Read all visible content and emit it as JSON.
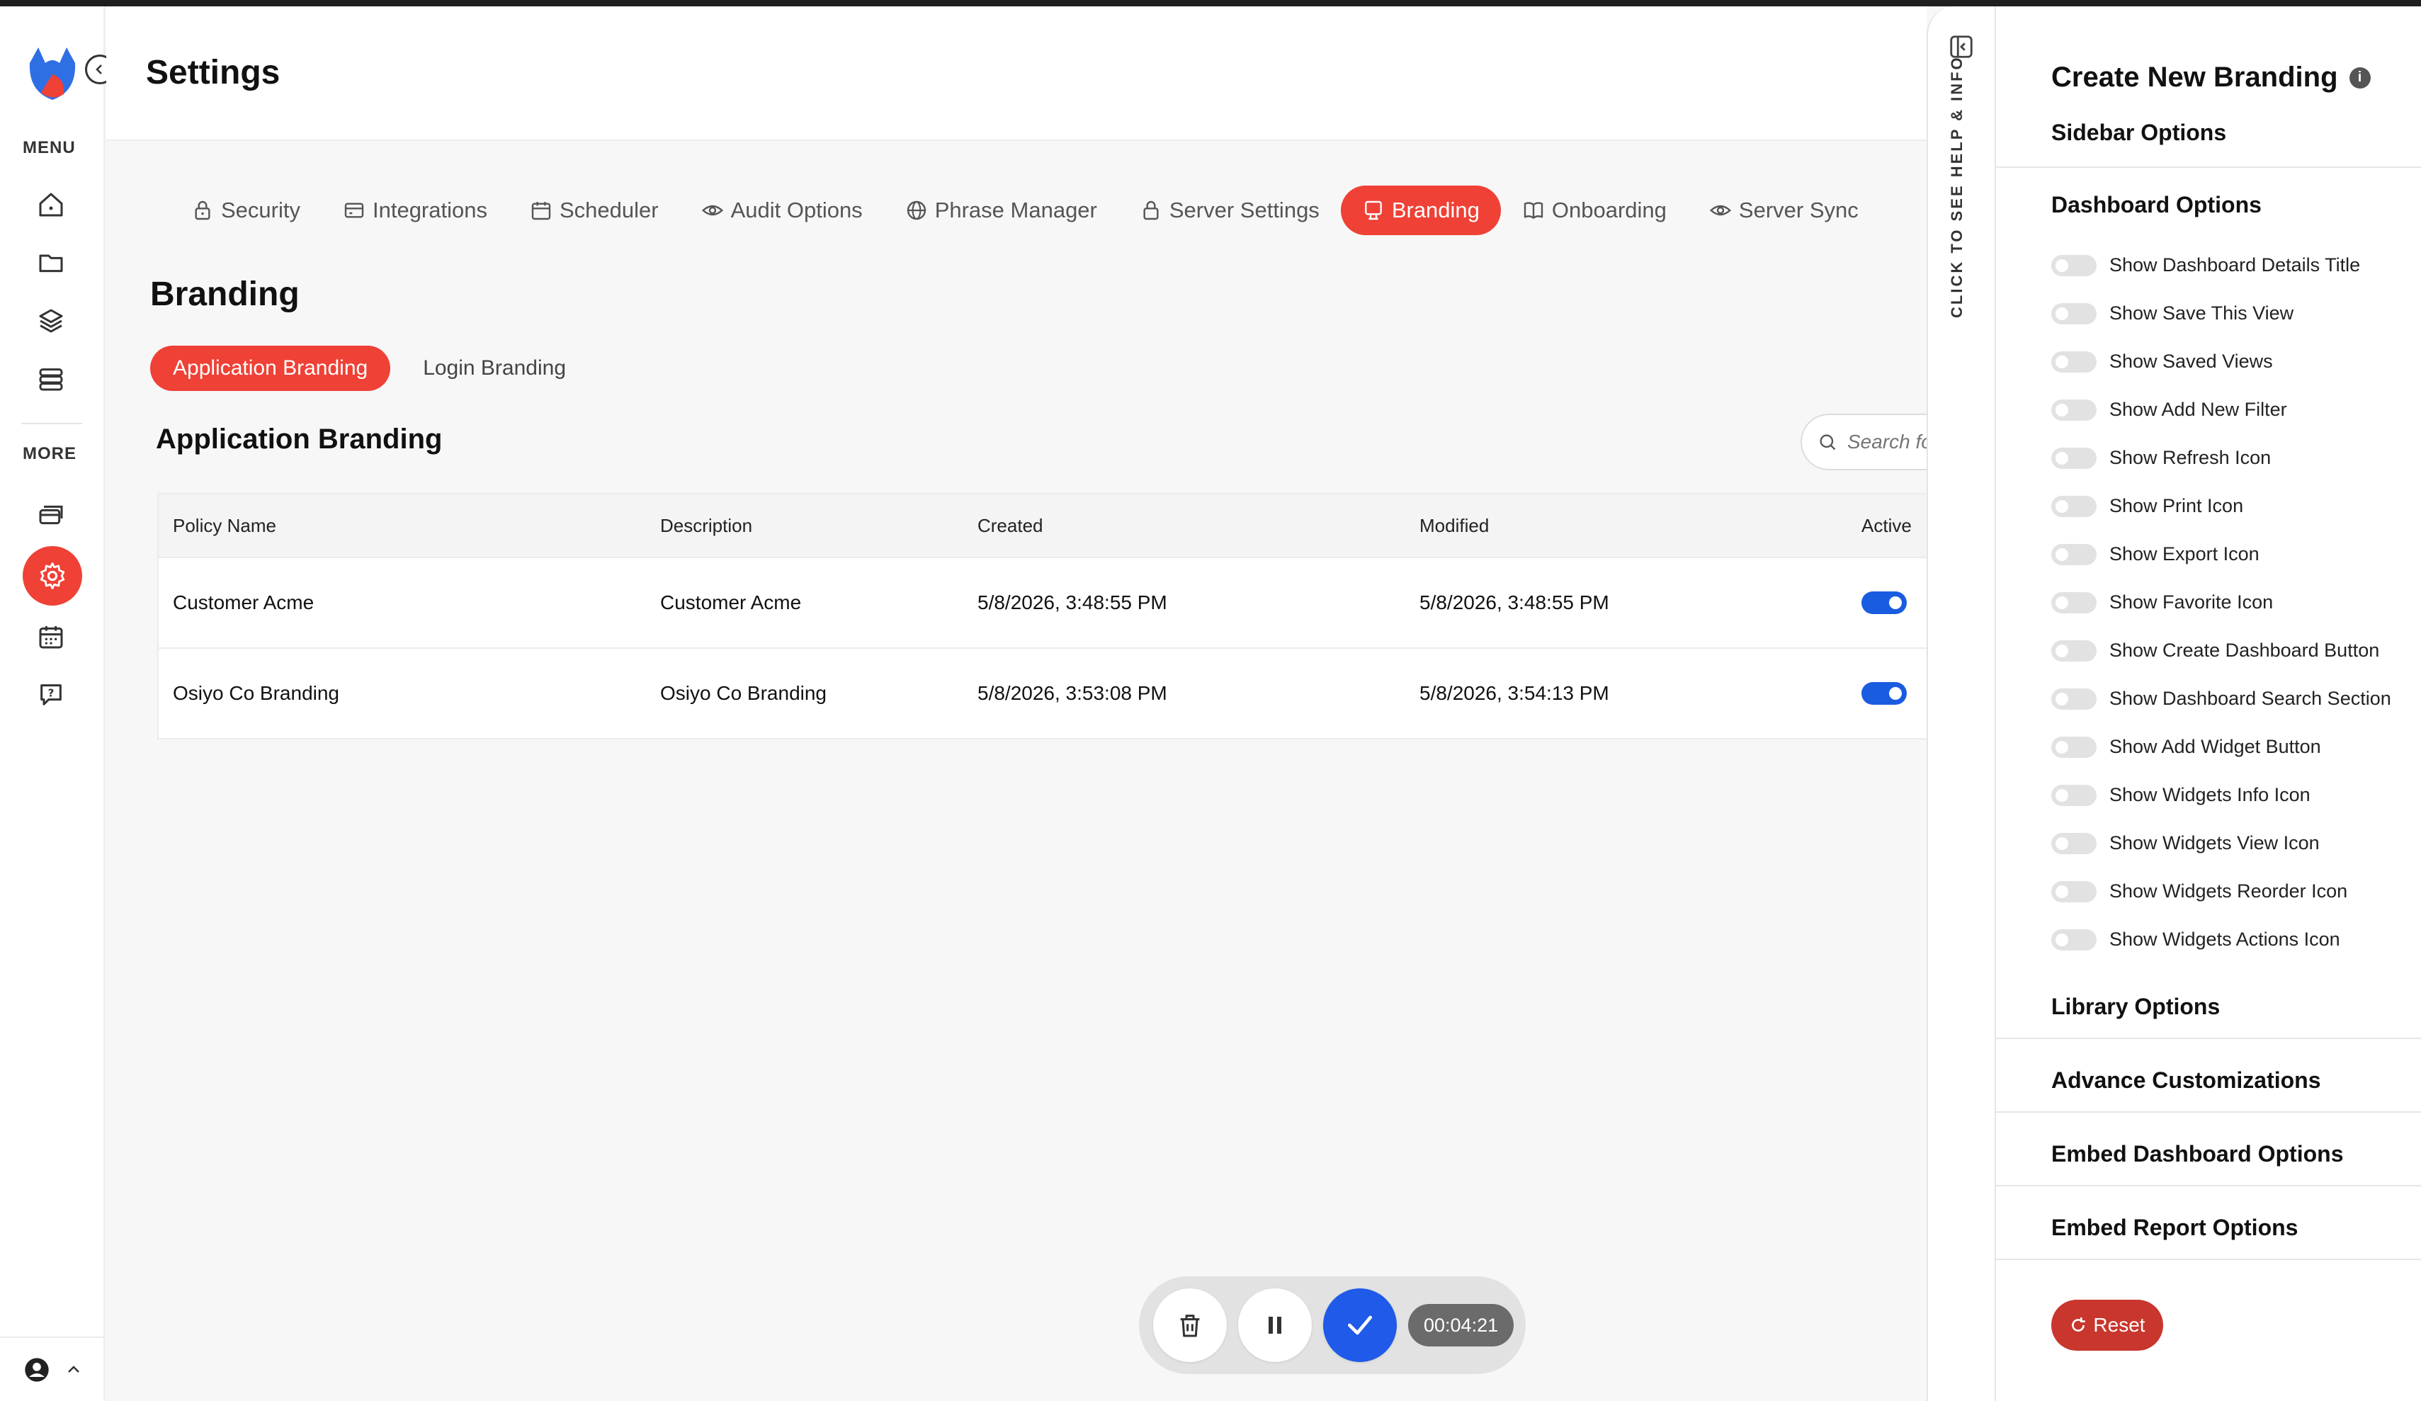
{
  "app": {
    "title": "Settings"
  },
  "rail": {
    "menu_label": "MENU",
    "more_label": "MORE",
    "menu_items": [
      "home-icon",
      "folder-icon",
      "layers-icon",
      "database-icon"
    ],
    "more_items": [
      "cards-icon",
      "gear-icon",
      "calendar-icon",
      "help-chat-icon"
    ]
  },
  "tabs": [
    {
      "label": "Security",
      "icon": "lock-icon"
    },
    {
      "label": "Integrations",
      "icon": "card-icon"
    },
    {
      "label": "Scheduler",
      "icon": "calendar-icon"
    },
    {
      "label": "Audit Options",
      "icon": "eye-icon"
    },
    {
      "label": "Phrase Manager",
      "icon": "globe-icon"
    },
    {
      "label": "Server Settings",
      "icon": "lock-icon"
    },
    {
      "label": "Branding",
      "icon": "branding-icon",
      "active": true
    },
    {
      "label": "Onboarding",
      "icon": "book-icon"
    },
    {
      "label": "Server Sync",
      "icon": "eye-icon"
    }
  ],
  "branding": {
    "title": "Branding",
    "subtabs": [
      "Application Branding",
      "Login Branding"
    ],
    "table_title": "Application Branding",
    "search_placeholder": "Search fo",
    "columns": [
      "Policy Name",
      "Description",
      "Created",
      "Modified",
      "Active"
    ],
    "rows": [
      {
        "name": "Customer Acme",
        "description": "Customer Acme",
        "created": "5/8/2026, 3:48:55 PM",
        "modified": "5/8/2026, 3:48:55 PM",
        "active": true
      },
      {
        "name": "Osiyo Co Branding",
        "description": "Osiyo Co Branding",
        "created": "5/8/2026, 3:53:08 PM",
        "modified": "5/8/2026, 3:54:13 PM",
        "active": true
      }
    ]
  },
  "recorder": {
    "timer": "00:04:21"
  },
  "help_strip": {
    "label": "CLICK TO SEE HELP & INFO"
  },
  "panel": {
    "title": "Create New Branding",
    "sidebar_options": "Sidebar Options",
    "dashboard_options": "Dashboard Options",
    "dashboard_toggles": [
      "Show Dashboard Details Title",
      "Show Save This View",
      "Show Saved Views",
      "Show Add New Filter",
      "Show Refresh Icon",
      "Show Print Icon",
      "Show Export Icon",
      "Show Favorite Icon",
      "Show Create Dashboard Button",
      "Show Dashboard Search Section",
      "Show Add Widget Button",
      "Show Widgets Info Icon",
      "Show Widgets View Icon",
      "Show Widgets Reorder Icon",
      "Show Widgets Actions Icon"
    ],
    "library_options": "Library Options",
    "advance_customizations": "Advance Customizations",
    "embed_dashboard_options": "Embed Dashboard Options",
    "embed_report_options": "Embed Report Options",
    "reset_label": "Reset"
  },
  "colors": {
    "accent": "#ef4136",
    "toggle_on": "#1a5ce0",
    "confirm": "#1f5ae8"
  }
}
